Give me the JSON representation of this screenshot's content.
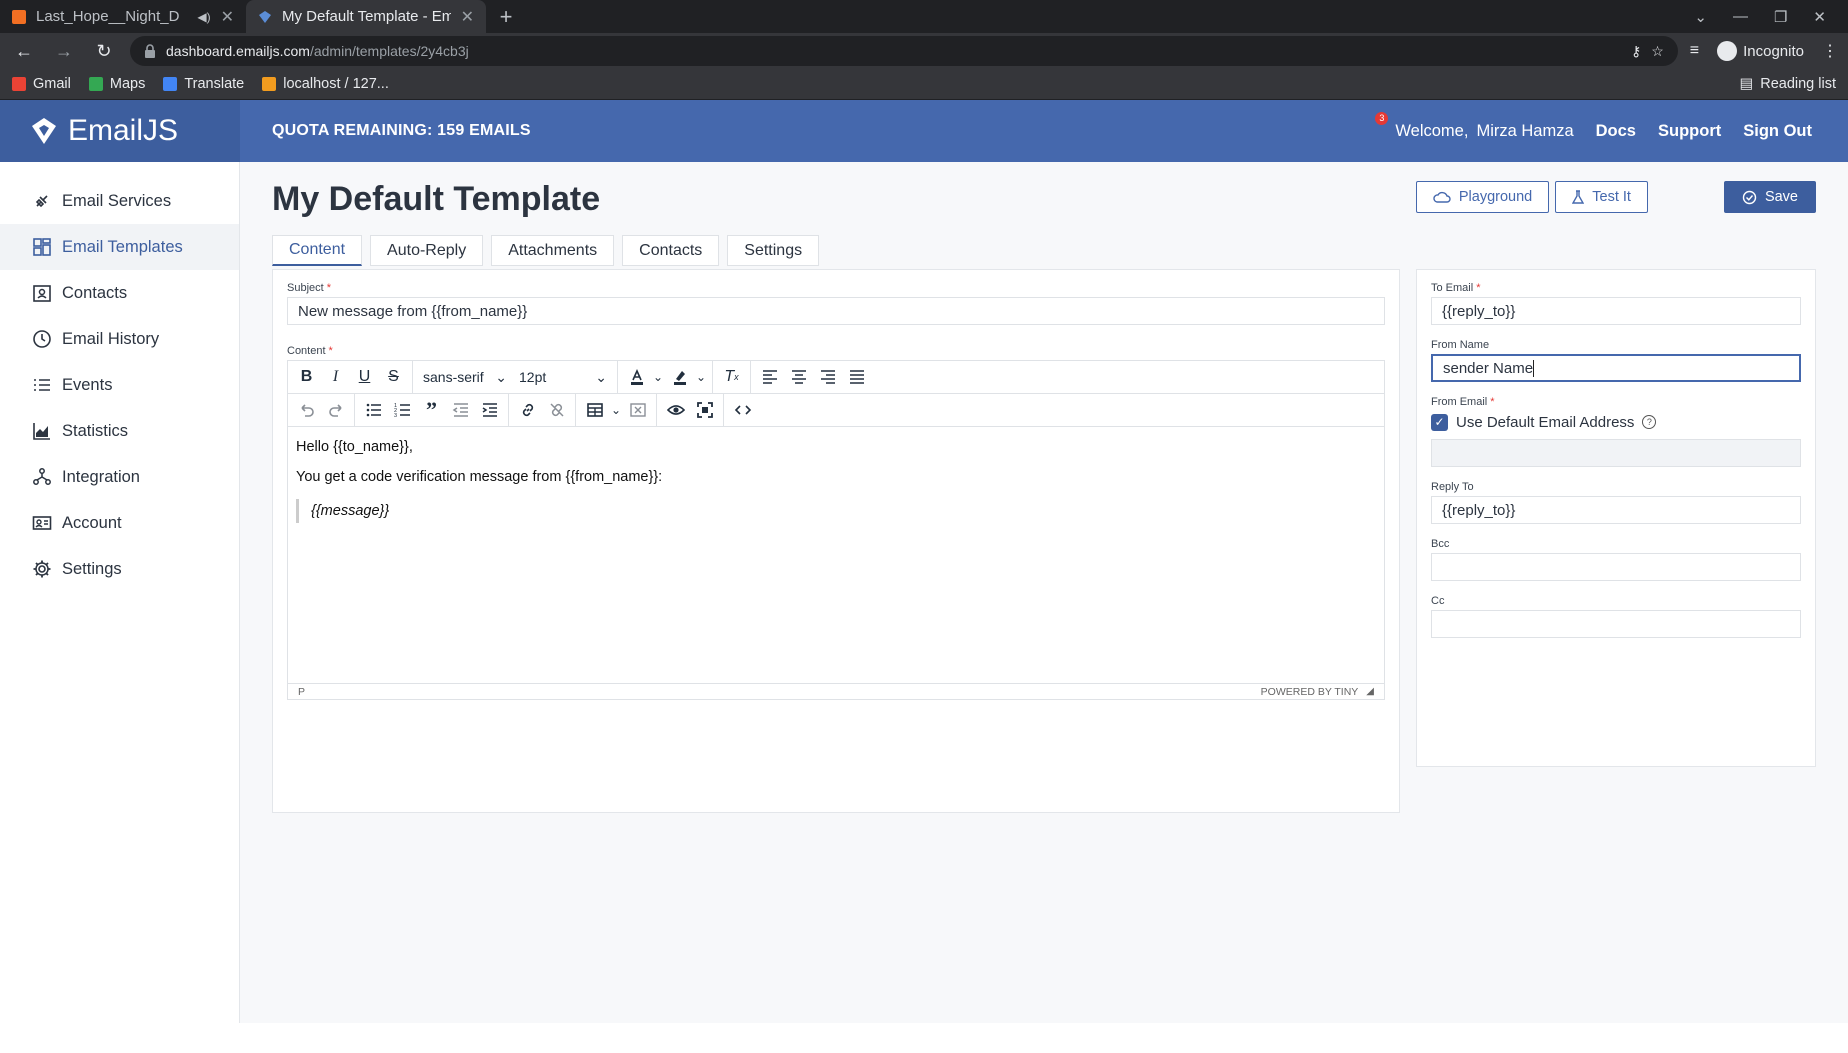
{
  "browser": {
    "tabs": [
      {
        "title": "Last_Hope__Night_D",
        "active": false
      },
      {
        "title": "My Default Template - Em",
        "active": true
      }
    ],
    "url_host": "dashboard.emailjs.com",
    "url_path": "/admin/templates/2y4cb3j",
    "profile_label": "Incognito",
    "bookmarks": [
      "Gmail",
      "Maps",
      "Translate",
      "localhost / 127..."
    ],
    "reading_list": "Reading list"
  },
  "header": {
    "brand": "EmailJS",
    "quota": "QUOTA REMAINING: 159 EMAILS",
    "notification_count": "3",
    "welcome": "Welcome,",
    "user": "Mirza Hamza",
    "links": [
      "Docs",
      "Support",
      "Sign Out"
    ]
  },
  "sidebar": {
    "items": [
      {
        "label": "Email Services",
        "icon": "plug-icon"
      },
      {
        "label": "Email Templates",
        "icon": "templates-icon",
        "active": true
      },
      {
        "label": "Contacts",
        "icon": "contacts-icon"
      },
      {
        "label": "Email History",
        "icon": "history-icon"
      },
      {
        "label": "Events",
        "icon": "list-icon"
      },
      {
        "label": "Statistics",
        "icon": "chart-icon"
      },
      {
        "label": "Integration",
        "icon": "integration-icon"
      },
      {
        "label": "Account",
        "icon": "account-icon"
      },
      {
        "label": "Settings",
        "icon": "gear-icon"
      }
    ]
  },
  "page": {
    "title": "My Default Template",
    "buttons": {
      "playground": "Playground",
      "test": "Test It",
      "save": "Save"
    },
    "tabs": [
      "Content",
      "Auto-Reply",
      "Attachments",
      "Contacts",
      "Settings"
    ]
  },
  "form": {
    "subject_label": "Subject",
    "subject_value": "New message from {{from_name}}",
    "content_label": "Content",
    "font_family": "sans-serif",
    "font_size": "12pt",
    "body": {
      "line1": "Hello {{to_name}},",
      "line2": "You get a code verification message from {{from_name}}:",
      "quote": "{{message}}"
    },
    "status_path": "P",
    "powered_by": "POWERED BY TINY"
  },
  "right": {
    "to_email_label": "To Email",
    "to_email_value": "{{reply_to}}",
    "from_name_label": "From Name",
    "from_name_value": "sender Name",
    "from_email_label": "From Email",
    "use_default_label": "Use Default Email Address",
    "use_default_checked": true,
    "reply_to_label": "Reply To",
    "reply_to_value": "{{reply_to}}",
    "bcc_label": "Bcc",
    "bcc_value": "",
    "cc_label": "Cc",
    "cc_value": ""
  },
  "colors": {
    "header": "#4568ad",
    "brand_bg": "#3d5e9e",
    "accent": "#3d5e9e",
    "required": "#e53935"
  }
}
